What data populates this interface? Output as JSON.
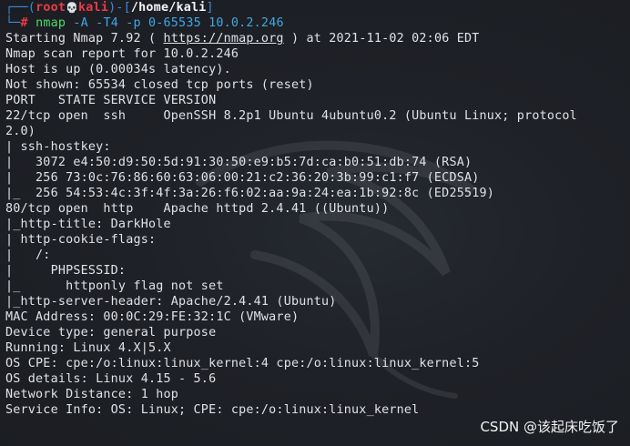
{
  "prompt": {
    "frame_left": "┌──(",
    "user": "root",
    "skull": "💀",
    "host": "kali",
    "frame_mid": ")-[",
    "path": "/home/kali",
    "frame_right": "]",
    "line2_prefix": "└─",
    "symbol": "#",
    "command_name": "nmap",
    "command_args": "-A -T4 -p 0-65535 10.0.2.246"
  },
  "output": {
    "l01_a": "Starting Nmap 7.92 ( ",
    "l01_url": "https://nmap.org",
    "l01_b": " ) at 2021-11-02 02:06 EDT",
    "l02": "Nmap scan report for 10.0.2.246",
    "l03": "Host is up (0.00034s latency).",
    "l04": "Not shown: 65534 closed tcp ports (reset)",
    "l05": "PORT   STATE SERVICE VERSION",
    "l06": "22/tcp open  ssh     OpenSSH 8.2p1 Ubuntu 4ubuntu0.2 (Ubuntu Linux; protocol",
    "l07": "2.0)",
    "l08": "| ssh-hostkey:",
    "l09": "|   3072 e4:50:d9:50:5d:91:30:50:e9:b5:7d:ca:b0:51:db:74 (RSA)",
    "l10": "|   256 73:0c:76:86:60:63:06:00:21:c2:36:20:3b:99:c1:f7 (ECDSA)",
    "l11": "|_  256 54:53:4c:3f:4f:3a:26:f6:02:aa:9a:24:ea:1b:92:8c (ED25519)",
    "l12": "80/tcp open  http    Apache httpd 2.4.41 ((Ubuntu))",
    "l13": "|_http-title: DarkHole",
    "l14": "| http-cookie-flags:",
    "l15": "|   /:",
    "l16": "|     PHPSESSID:",
    "l17": "|_      httponly flag not set",
    "l18": "|_http-server-header: Apache/2.4.41 (Ubuntu)",
    "l19": "MAC Address: 00:0C:29:FE:32:1C (VMware)",
    "l20": "Device type: general purpose",
    "l21": "Running: Linux 4.X|5.X",
    "l22": "OS CPE: cpe:/o:linux:linux_kernel:4 cpe:/o:linux:linux_kernel:5",
    "l23": "OS details: Linux 4.15 - 5.6",
    "l24": "Network Distance: 1 hop",
    "l25": "Service Info: OS: Linux; CPE: cpe:/o:linux:linux_kernel"
  },
  "watermark": "CSDN @该起床吃饭了",
  "colors": {
    "background": "#1b1e24",
    "text": "#dfe2e6",
    "prompt_frame": "#3f8ad6",
    "prompt_user": "#ea3b47",
    "command": "#4ddc6a",
    "args": "#3fa7e6"
  }
}
